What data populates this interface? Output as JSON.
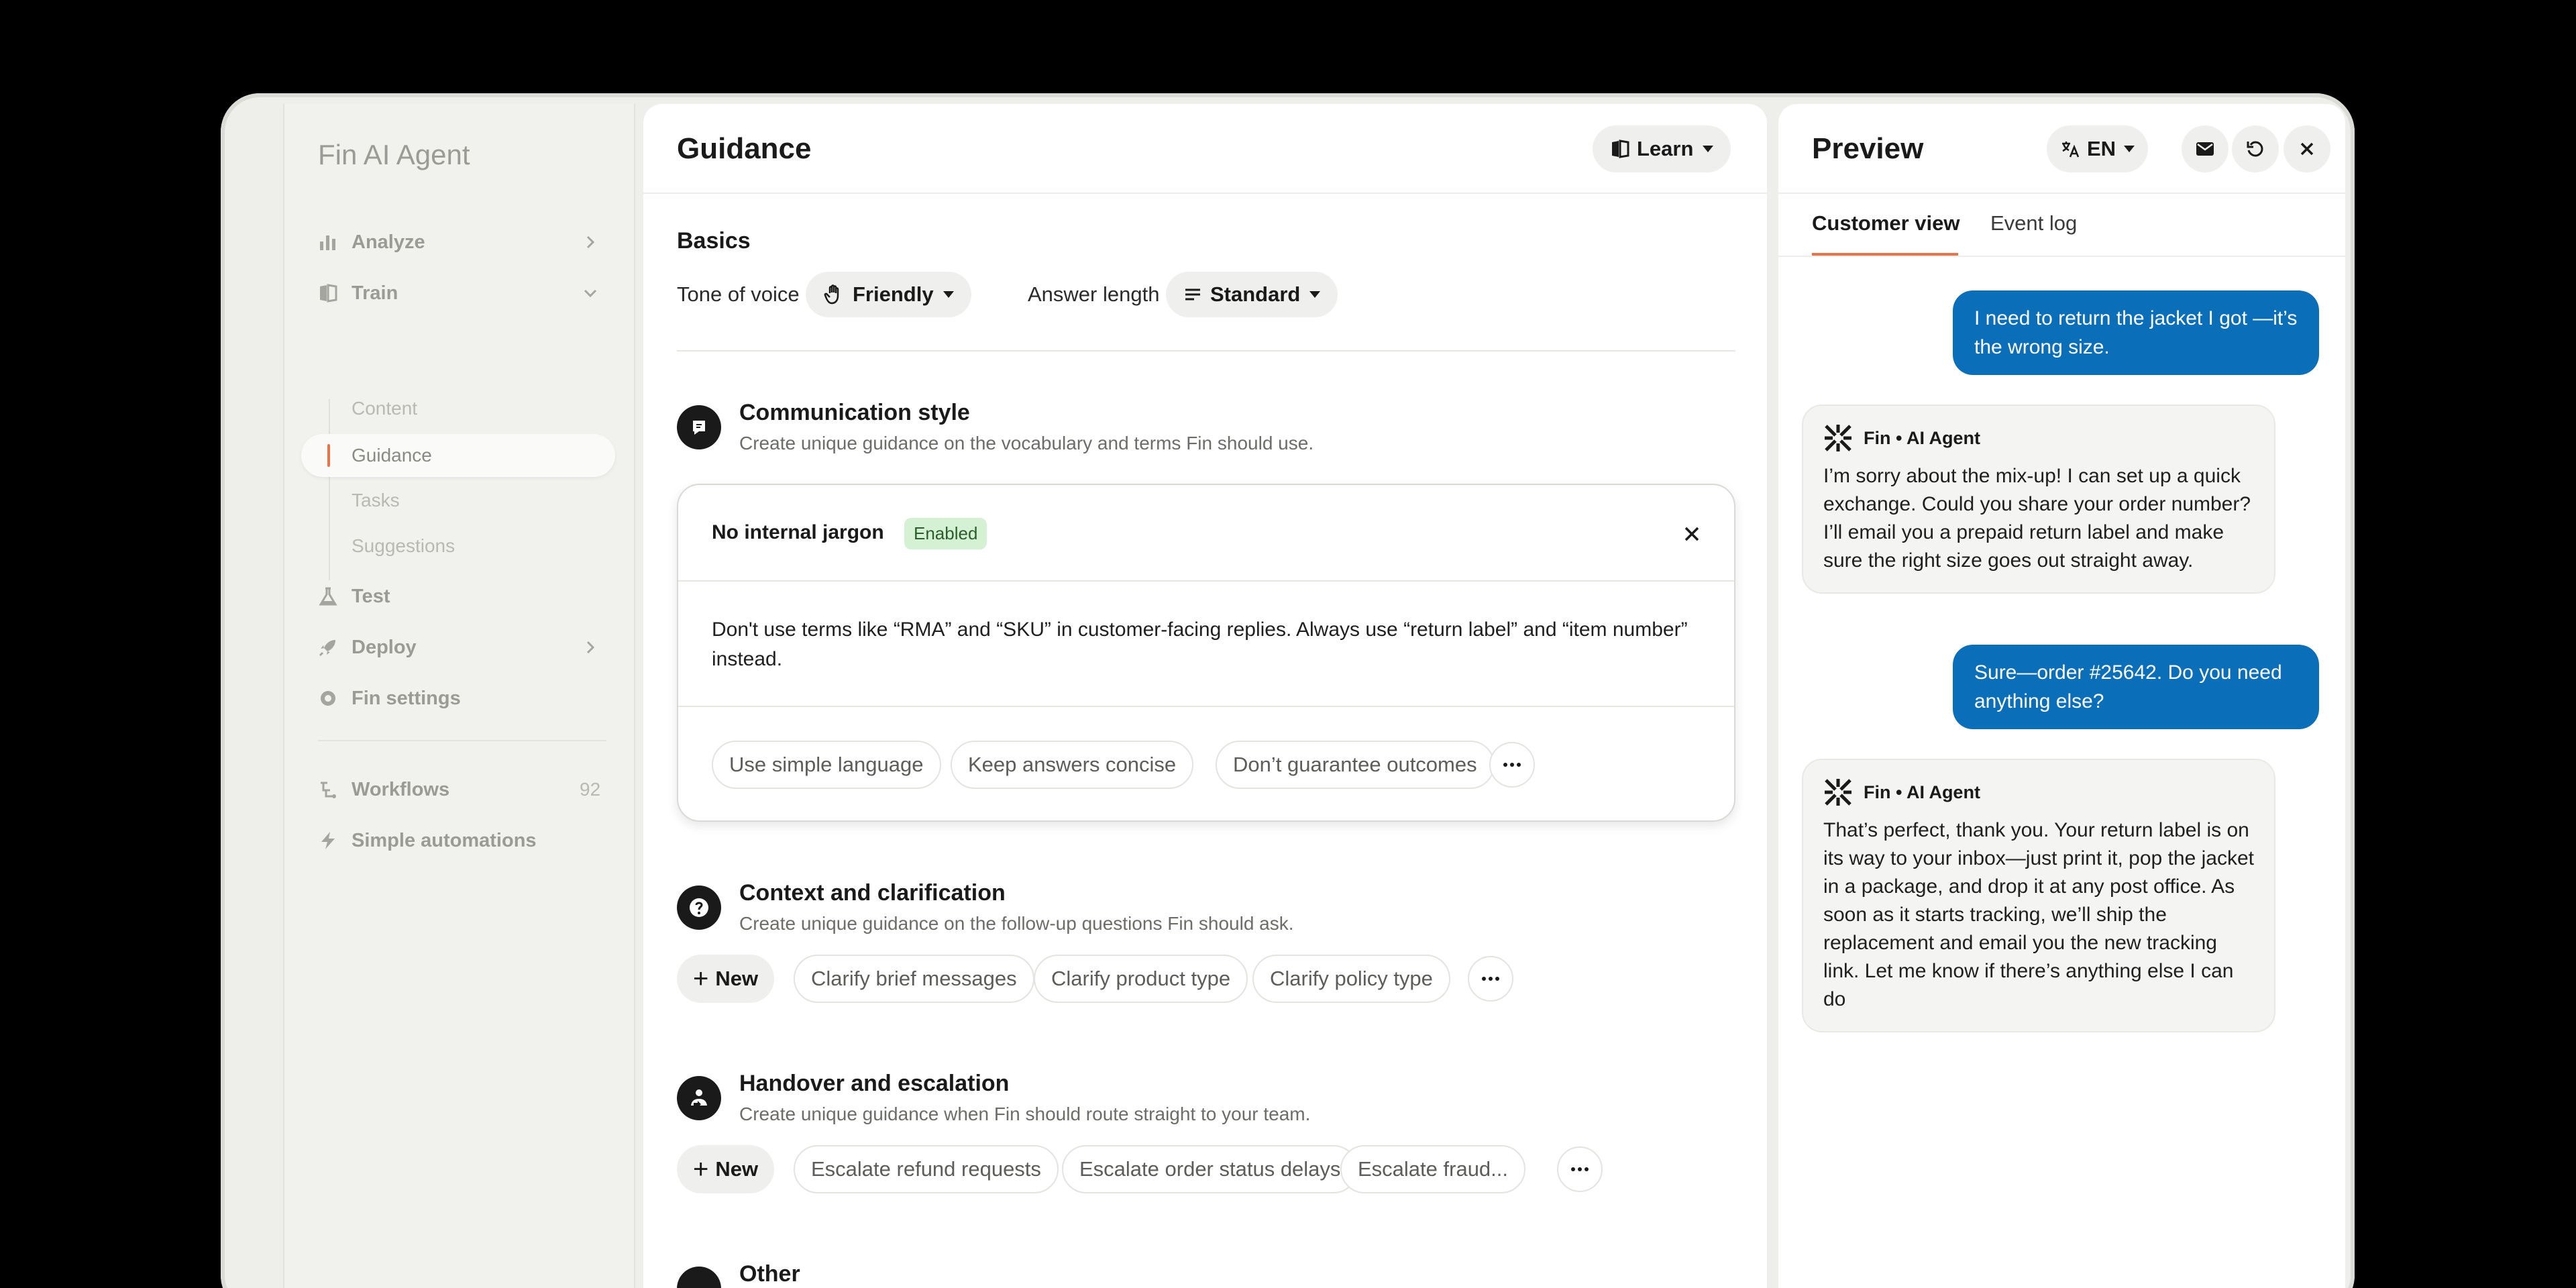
{
  "sidebar": {
    "app_title": "Fin AI Agent",
    "items": [
      {
        "label": "Analyze",
        "icon": "bar-chart-icon"
      },
      {
        "label": "Train",
        "icon": "book-icon"
      },
      {
        "label": "Test",
        "icon": "flask-icon"
      },
      {
        "label": "Deploy",
        "icon": "rocket-icon"
      },
      {
        "label": "Fin settings",
        "icon": "gear-icon"
      }
    ],
    "train_sub": [
      "Content",
      "Guidance",
      "Tasks",
      "Suggestions"
    ],
    "workflows": {
      "label": "Workflows",
      "count": "92"
    },
    "automations": {
      "label": "Simple automations"
    }
  },
  "main": {
    "title": "Guidance",
    "learn_label": "Learn",
    "basics": {
      "title": "Basics",
      "tone_label": "Tone of voice",
      "tone_value": "Friendly",
      "length_label": "Answer length",
      "length_value": "Standard"
    },
    "sections": [
      {
        "title": "Communication style",
        "desc": "Create unique guidance on the vocabulary and terms Fin should use.",
        "card": {
          "title": "No internal jargon",
          "badge": "Enabled",
          "body": "Don't use terms like “RMA” and “SKU” in customer-facing replies. Always use “return label” and “item number” instead."
        },
        "pills": [
          "Use simple language",
          "Keep answers concise",
          "Don’t guarantee outcomes"
        ]
      },
      {
        "title": "Context and clarification",
        "desc": "Create unique guidance on the follow-up questions Fin should ask.",
        "new_label": "New",
        "pills": [
          "Clarify brief messages",
          "Clarify product type",
          "Clarify policy type"
        ]
      },
      {
        "title": "Handover and escalation",
        "desc": "Create unique guidance when Fin should route straight to your team.",
        "new_label": "New",
        "pills": [
          "Escalate refund requests",
          "Escalate order status delays",
          "Escalate fraud..."
        ]
      },
      {
        "title": "Other"
      }
    ]
  },
  "preview": {
    "title": "Preview",
    "lang": "EN",
    "tabs": [
      "Customer view",
      "Event log"
    ],
    "messages": [
      {
        "from": "user",
        "text": "I need to return the jacket I got —it’s the wrong size."
      },
      {
        "from": "bot",
        "sender": "Fin • AI Agent",
        "text": "I’m sorry about the mix-up! I can set up a quick exchange. Could you share your order number? I’ll email you a prepaid return label and make sure the right size goes out straight away."
      },
      {
        "from": "user",
        "text": "Sure—order #25642. Do you need anything else?"
      },
      {
        "from": "bot",
        "sender": "Fin • AI Agent",
        "text": "That’s perfect, thank you. Your return label is on its way to your inbox—just print it, pop the jacket in a package, and drop it at any post office. As soon as it starts tracking, we’ll ship the replacement and email you the new tracking link. Let me know if there’s anything else I can do"
      }
    ]
  },
  "colors": {
    "accent": "#e8744a",
    "user_bubble": "#0a6fb8",
    "badge_bg": "#d5f1d3"
  }
}
